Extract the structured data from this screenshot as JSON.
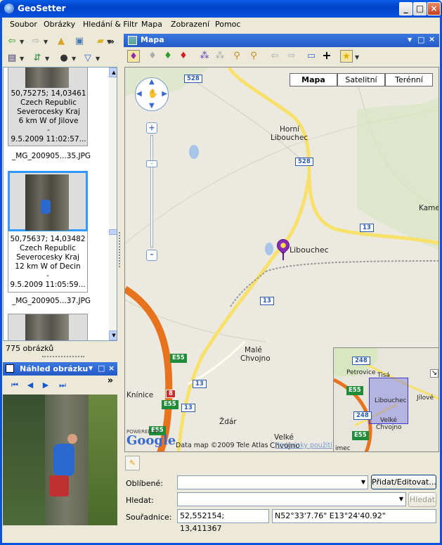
{
  "app": {
    "title": "GeoSetter"
  },
  "menu": [
    "Soubor",
    "Obrázky",
    "Hledání & Filtr",
    "Mapa",
    "Zobrazení",
    "Pomoc"
  ],
  "thumbs": [
    {
      "lines": [
        "50,75275; 14,03461",
        "Czech Republic",
        "Severocesky Kraj",
        "6 km W  of Jilove",
        "-",
        "9.5.2009 11:02:57..."
      ],
      "file": "_MG_200905...35.JPG"
    },
    {
      "lines": [
        "50,75637; 14,03482",
        "Czech Republic",
        "Severocesky Kraj",
        "12 km W  of Decin",
        "-",
        "9.5.2009 11:05:59..."
      ],
      "file": "_MG_200905...37.JPG"
    }
  ],
  "status": {
    "count": "775 obrázků"
  },
  "preview": {
    "title": "Náhled obrázku"
  },
  "mappanel": {
    "title": "Mapa"
  },
  "map": {
    "types": [
      "Mapa",
      "Satelitní",
      "Terénní"
    ],
    "marker_label": "Libouchec",
    "places": [
      "Horní",
      "Libouchec",
      "Kame",
      "Malé",
      "Chvojno",
      "Knínice",
      "Ždár",
      "Velké",
      "Chvojno"
    ],
    "roads": [
      "528",
      "528",
      "13",
      "13",
      "13",
      "13",
      "8"
    ],
    "euroroads": [
      "E55",
      "E55",
      "E55"
    ],
    "powered": "POWERED BY",
    "google": "Google",
    "copyright": "Data map ©2009 Tele Atlas",
    "terms": "Podmínky použití",
    "overview": {
      "places": [
        "Petrovice",
        "Tisá",
        "Libouchec",
        "Jílové",
        "Velké",
        "Chvojno",
        "imec"
      ],
      "roads": [
        "248",
        "248"
      ],
      "euroroads": [
        "E55",
        "E55"
      ]
    }
  },
  "form": {
    "fav_label": "Oblíbené:",
    "fav_button": "Přidat/Editovat...",
    "search_label": "Hledat:",
    "search_button": "Hledat",
    "coord_label": "Souřadnice:",
    "coord_decimal": "52,552154; 13,411367",
    "coord_dms": "N52°33'7.76\" E13°24'40.92\""
  },
  "colors": {
    "titlebar": "#0a52de",
    "selection": "#3399ff",
    "motorway": "#e8731e",
    "road": "#f7e16b",
    "euro": "#1f8c3a",
    "marker": "#8a2bb8"
  }
}
